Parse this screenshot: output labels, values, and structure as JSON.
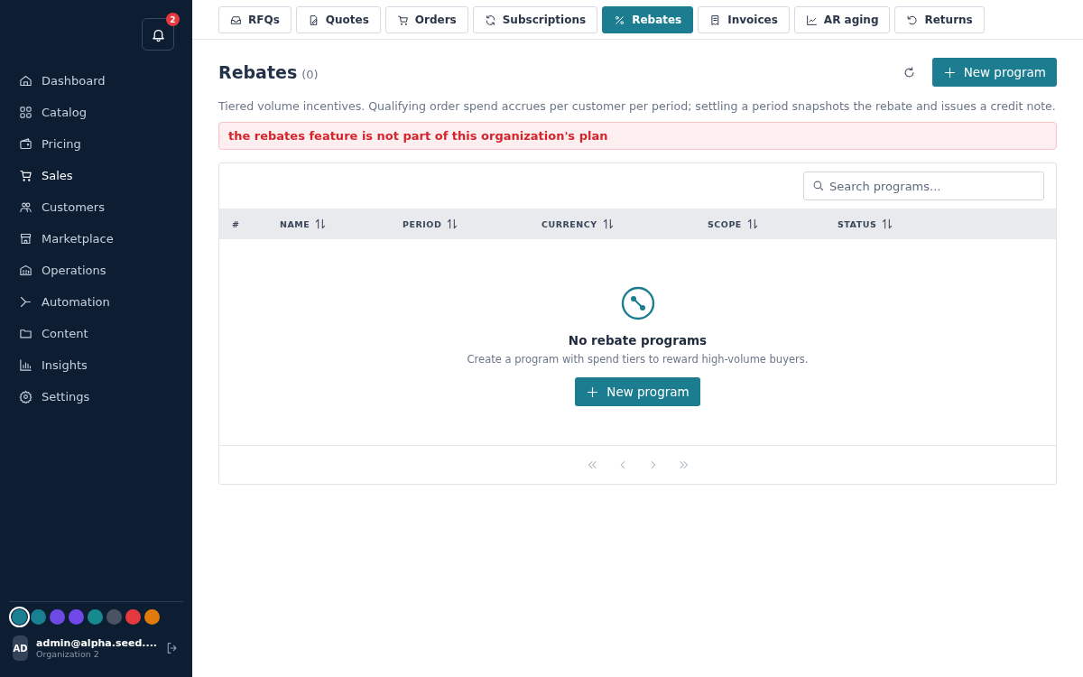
{
  "sidebar": {
    "notifications": {
      "count": "2"
    },
    "items": [
      {
        "label": "Dashboard",
        "selected": false
      },
      {
        "label": "Catalog",
        "selected": false
      },
      {
        "label": "Pricing",
        "selected": false
      },
      {
        "label": "Sales",
        "selected": true
      },
      {
        "label": "Customers",
        "selected": false
      },
      {
        "label": "Marketplace",
        "selected": false
      },
      {
        "label": "Operations",
        "selected": false
      },
      {
        "label": "Automation",
        "selected": false
      },
      {
        "label": "Content",
        "selected": false
      },
      {
        "label": "Insights",
        "selected": false
      },
      {
        "label": "Settings",
        "selected": false
      }
    ],
    "themes": [
      {
        "color": "#1a7f91",
        "selected": true
      },
      {
        "color": "#1a7f91",
        "selected": false
      },
      {
        "color": "#6d4ae6",
        "selected": false
      },
      {
        "color": "#7047e8",
        "selected": false
      },
      {
        "color": "#168a8f",
        "selected": false
      },
      {
        "color": "#4a5363",
        "selected": false
      },
      {
        "color": "#e5383f",
        "selected": false
      },
      {
        "color": "#e07b0b",
        "selected": false
      }
    ],
    "user": {
      "initials": "AD",
      "email": "admin@alpha.seed....",
      "org": "Organization 2"
    }
  },
  "tabs": [
    {
      "label": "RFQs",
      "selected": false
    },
    {
      "label": "Quotes",
      "selected": false
    },
    {
      "label": "Orders",
      "selected": false
    },
    {
      "label": "Subscriptions",
      "selected": false
    },
    {
      "label": "Rebates",
      "selected": true
    },
    {
      "label": "Invoices",
      "selected": false
    },
    {
      "label": "AR aging",
      "selected": false
    },
    {
      "label": "Returns",
      "selected": false
    }
  ],
  "page": {
    "title": "Rebates",
    "count": "(0)",
    "new_button": "New program",
    "description": "Tiered volume incentives. Qualifying order spend accrues per customer per period; settling a period snapshots the rebate and issues a credit note.",
    "error": "the rebates feature is not part of this organization's plan"
  },
  "table": {
    "search": {
      "placeholder": "Search programs..."
    },
    "columns": [
      {
        "label": "#",
        "sortable": false
      },
      {
        "label": "NAME",
        "sortable": true
      },
      {
        "label": "PERIOD",
        "sortable": true
      },
      {
        "label": "CURRENCY",
        "sortable": true
      },
      {
        "label": "SCOPE",
        "sortable": true
      },
      {
        "label": "STATUS",
        "sortable": true
      }
    ],
    "empty": {
      "title": "No rebate programs",
      "text": "Create a program with spend tiers to reward high-volume buyers.",
      "button": "New program"
    }
  }
}
